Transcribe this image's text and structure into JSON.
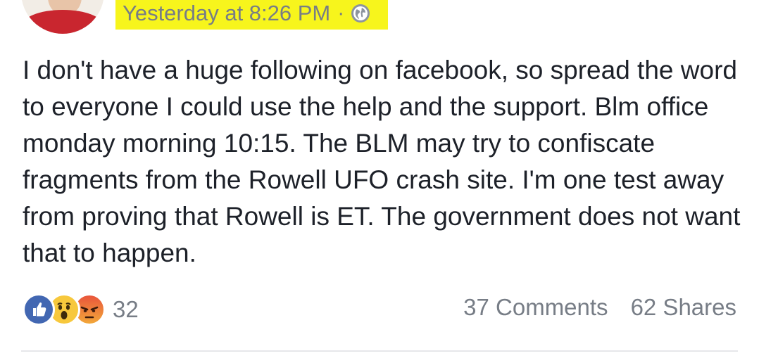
{
  "post": {
    "timestamp": "Yesterday at 8:26 PM",
    "separator": "·",
    "privacy_icon": "globe-icon",
    "highlight_color": "#f7f51c",
    "text": "I don't have a huge following on facebook, so spread the word to everyone I could use the help and the support. Blm office monday morning 10:15. The BLM may try to confiscate fragments from the Rowell UFO crash site. I'm one test away from proving that Rowell is ET. The government does not want that to happen."
  },
  "reactions": {
    "icons": [
      "like-icon",
      "wow-icon",
      "angry-icon"
    ],
    "count": "32"
  },
  "stats": {
    "comments": "37 Comments",
    "shares": "62 Shares"
  }
}
